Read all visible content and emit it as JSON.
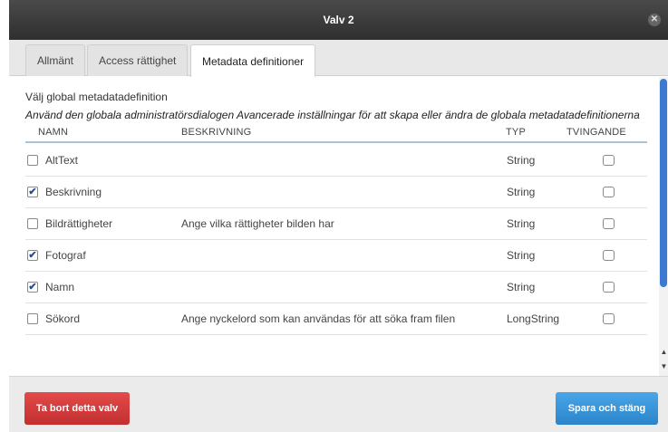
{
  "dialog": {
    "title": "Valv 2",
    "close_icon": "close-icon"
  },
  "tabs": [
    {
      "label": "Allmänt",
      "active": false
    },
    {
      "label": "Access rättighet",
      "active": false
    },
    {
      "label": "Metadata definitioner",
      "active": true
    }
  ],
  "metadata": {
    "section_title": "Välj global metadatadefinition",
    "description": "Använd den globala administratörsdialogen Avancerade inställningar för att skapa eller ändra de globala metadatadefinitionerna",
    "columns": {
      "name": "NAMN",
      "description": "BESKRIVNING",
      "type": "TYP",
      "required": "TVINGANDE"
    },
    "rows": [
      {
        "selected": false,
        "name": "AltText",
        "description": "",
        "type": "String",
        "required": false
      },
      {
        "selected": true,
        "name": "Beskrivning",
        "description": "",
        "type": "String",
        "required": false
      },
      {
        "selected": false,
        "name": "Bildrättigheter",
        "description": "Ange vilka rättigheter bilden har",
        "type": "String",
        "required": false
      },
      {
        "selected": true,
        "name": "Fotograf",
        "description": "",
        "type": "String",
        "required": false
      },
      {
        "selected": true,
        "name": "Namn",
        "description": "",
        "type": "String",
        "required": false
      },
      {
        "selected": false,
        "name": "Sökord",
        "description": "Ange nyckelord som kan användas för att söka fram filen",
        "type": "LongString",
        "required": false
      }
    ]
  },
  "footer": {
    "delete_label": "Ta bort detta valv",
    "save_label": "Spara och stäng"
  },
  "colors": {
    "delete_button": "#d63a3a",
    "save_button": "#3a97dc",
    "scrollbar": "#3b7ad0",
    "header_rule": "#a8c4da"
  }
}
